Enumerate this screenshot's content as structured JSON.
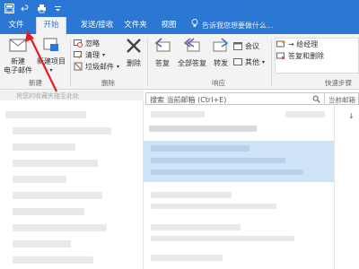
{
  "tabs": {
    "file": "文件",
    "start": "开始",
    "send_receive": "发送/接收",
    "folder": "文件夹",
    "view": "视图"
  },
  "tell_me": "告诉我您想要做什么...",
  "ribbon": {
    "new_email": "新建\n电子邮件",
    "new_item": "新建项目",
    "group_new": "新建",
    "ignore": "忽略",
    "cleanup": "清理",
    "junk": "垃圾邮件",
    "delete": "删除",
    "group_delete": "删除",
    "reply": "答复",
    "reply_all": "全部答复",
    "forward": "转发",
    "meeting": "会议",
    "more": "其他",
    "group_respond": "响应",
    "to_manager": "→ 给经理",
    "reply_delete": "答复和删除",
    "group_quick": "快速步骤"
  },
  "nav": {
    "favorites_hint": "将您的收藏夹拖至此处"
  },
  "search": {
    "placeholder": "搜索 当前邮箱 (Ctrl+E)",
    "scope": "当前邮箱"
  },
  "colors": {
    "accent": "#2b78d4",
    "annotation_arrow": "#e02020",
    "selected_row": "#cfe3f6"
  }
}
